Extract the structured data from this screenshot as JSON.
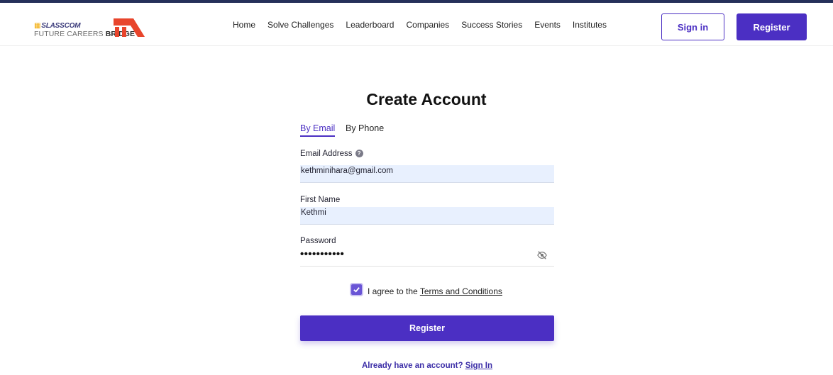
{
  "header": {
    "logo": {
      "top_text": "SLASSCOM",
      "bottom_text_regular": "FUTURE CAREERS",
      "bottom_text_bold": "BRIDGE",
      "colors": {
        "mark": "#f2a900",
        "glyph": "#e8452c"
      }
    },
    "nav": [
      {
        "label": "Home"
      },
      {
        "label": "Solve Challenges"
      },
      {
        "label": "Leaderboard"
      },
      {
        "label": "Companies"
      },
      {
        "label": "Success Stories"
      },
      {
        "label": "Events"
      },
      {
        "label": "Institutes"
      }
    ],
    "sign_in_label": "Sign in",
    "register_label": "Register"
  },
  "form": {
    "title": "Create Account",
    "tabs": [
      {
        "label": "By Email",
        "active": true
      },
      {
        "label": "By Phone",
        "active": false
      }
    ],
    "email": {
      "label": "Email Address",
      "value": "kethminihara@gmail.com",
      "help_icon": "question-icon"
    },
    "first_name": {
      "label": "First Name",
      "value": "Kethmi"
    },
    "password": {
      "label": "Password",
      "masked_value": "•••••••••••",
      "toggle_icon": "eye-slash-icon"
    },
    "agree": {
      "checked": true,
      "text": "I agree to the",
      "link": "Terms and Conditions"
    },
    "submit_label": "Register",
    "footer": {
      "text": "Already have an account?",
      "link": "Sign In"
    }
  },
  "colors": {
    "primary": "#4b2fc3",
    "input_fill": "#e8f0fe",
    "top_bar": "#26315a"
  }
}
